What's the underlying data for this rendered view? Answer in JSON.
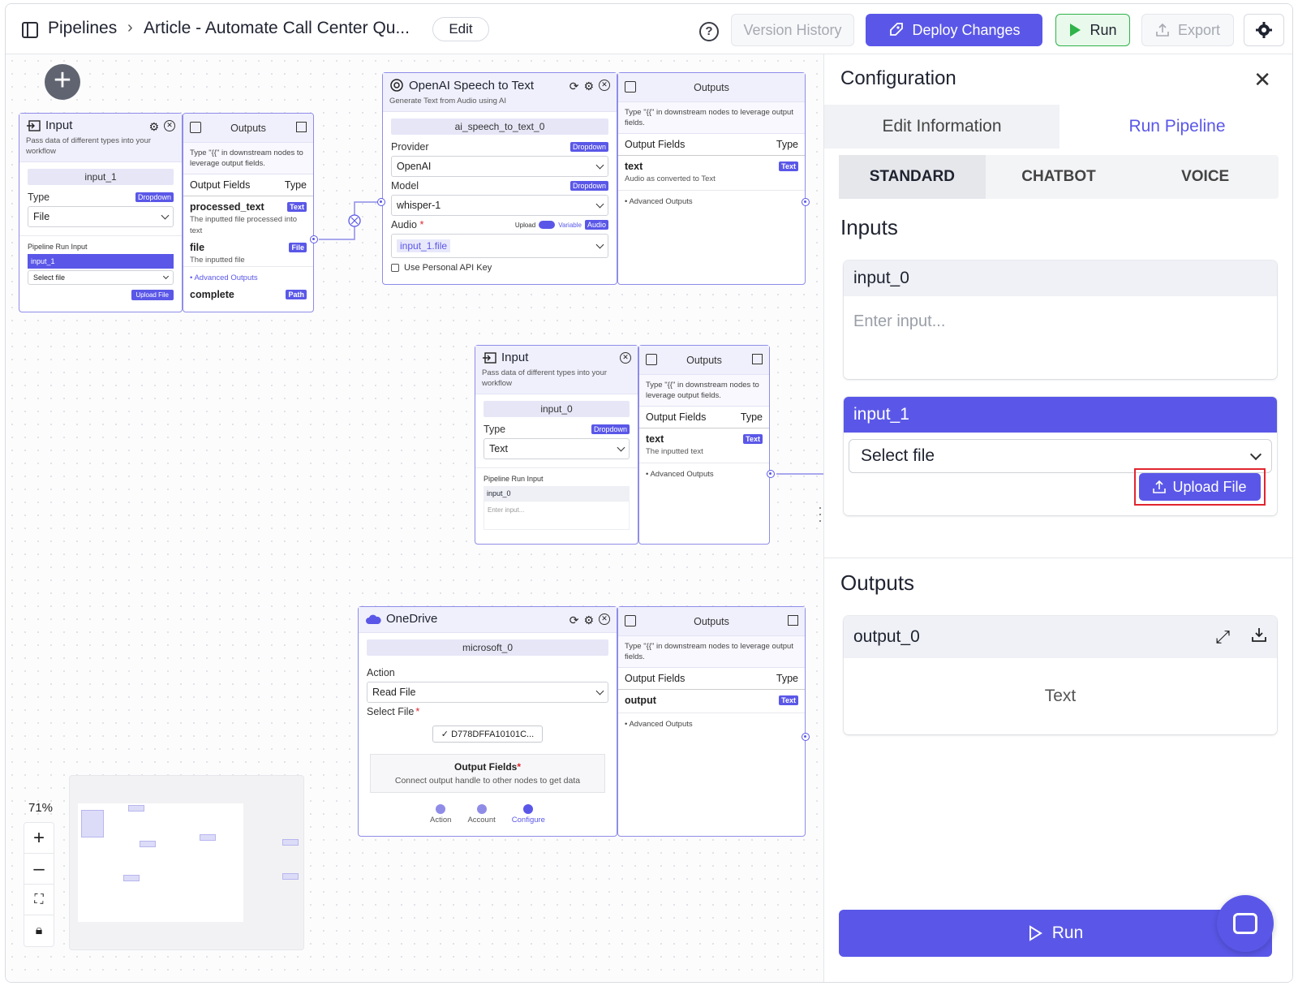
{
  "header": {
    "breadcrumb_root": "Pipelines",
    "breadcrumb_sep": "›",
    "pipeline_name": "Article - Automate Call Center Qu...",
    "edit_label": "Edit",
    "help_icon": "?",
    "version_history": "Version History",
    "deploy": "Deploy Changes",
    "run": "Run",
    "export": "Export"
  },
  "colors": {
    "accent": "#5a57e8",
    "run_green": "#2fb34a",
    "highlight_red": "#e0262f"
  },
  "nodes": {
    "input1": {
      "title": "Input",
      "subtitle": "Pass data of different types into your workflow",
      "id": "input_1",
      "type_label": "Type",
      "type_badge": "Dropdown",
      "type_value": "File",
      "run_input_label": "Pipeline Run Input",
      "run_input_name": "input_1",
      "select_file": "Select file",
      "upload": "Upload File"
    },
    "input1_out": {
      "title": "Outputs",
      "note": "Type \"{{\" in downstream nodes to leverage output fields.",
      "fields_label": "Output Fields",
      "type_label": "Type",
      "f1_name": "processed_text",
      "f1_badge": "Text",
      "f1_desc": "The inputted file processed into text",
      "f2_name": "file",
      "f2_badge": "File",
      "f2_desc": "The inputted file",
      "advanced": "Advanced Outputs",
      "f3_name": "complete",
      "f3_badge": "Path"
    },
    "speech": {
      "title": "OpenAI Speech to Text",
      "subtitle": "Generate Text from Audio using AI",
      "id": "ai_speech_to_text_0",
      "provider_label": "Provider",
      "provider_badge": "Dropdown",
      "provider_value": "OpenAI",
      "model_label": "Model",
      "model_badge": "Dropdown",
      "model_value": "whisper-1",
      "audio_label": "Audio",
      "audio_upload": "Upload",
      "audio_variable": "Variable",
      "audio_badge": "Audio",
      "audio_value": "input_1.file",
      "api_key": "Use Personal API Key"
    },
    "speech_out": {
      "title": "Outputs",
      "note": "Type \"{{\" in downstream nodes to leverage output fields.",
      "fields_label": "Output Fields",
      "type_label": "Type",
      "f1_name": "text",
      "f1_badge": "Text",
      "f1_desc": "Audio as converted to Text",
      "advanced": "Advanced Outputs"
    },
    "input0": {
      "title": "Input",
      "subtitle": "Pass data of different types into your workflow",
      "id": "input_0",
      "type_label": "Type",
      "type_badge": "Dropdown",
      "type_value": "Text",
      "run_input_label": "Pipeline Run Input",
      "run_input_name": "input_0",
      "placeholder": "Enter input..."
    },
    "input0_out": {
      "title": "Outputs",
      "note": "Type \"{{\" in downstream nodes to leverage output fields.",
      "fields_label": "Output Fields",
      "type_label": "Type",
      "f1_name": "text",
      "f1_badge": "Text",
      "f1_desc": "The inputted text",
      "advanced": "Advanced Outputs"
    },
    "onedrive": {
      "title": "OneDrive",
      "id": "microsoft_0",
      "action_label": "Action",
      "action_value": "Read File",
      "select_file_label": "Select File",
      "file_value": "D778DFFA10101C...",
      "of_title": "Output Fields",
      "of_desc": "Connect output handle to other nodes to get data",
      "steps": [
        "Action",
        "Account",
        "Configure"
      ]
    },
    "onedrive_out": {
      "title": "Outputs",
      "note": "Type \"{{\" in downstream nodes to leverage output fields.",
      "fields_label": "Output Fields",
      "type_label": "Type",
      "f1_name": "output",
      "f1_badge": "Text",
      "advanced": "Advanced Outputs"
    }
  },
  "zoom": {
    "level": "71%"
  },
  "panel": {
    "title": "Configuration",
    "tabs": [
      "Edit Information",
      "Run Pipeline"
    ],
    "modes": [
      "STANDARD",
      "CHATBOT",
      "VOICE"
    ],
    "inputs_title": "Inputs",
    "input0_name": "input_0",
    "input0_placeholder": "Enter input...",
    "input1_name": "input_1",
    "input1_select": "Select file",
    "upload_label": "Upload File",
    "outputs_title": "Outputs",
    "output0_name": "output_0",
    "output0_type": "Text",
    "run_label": "Run"
  }
}
